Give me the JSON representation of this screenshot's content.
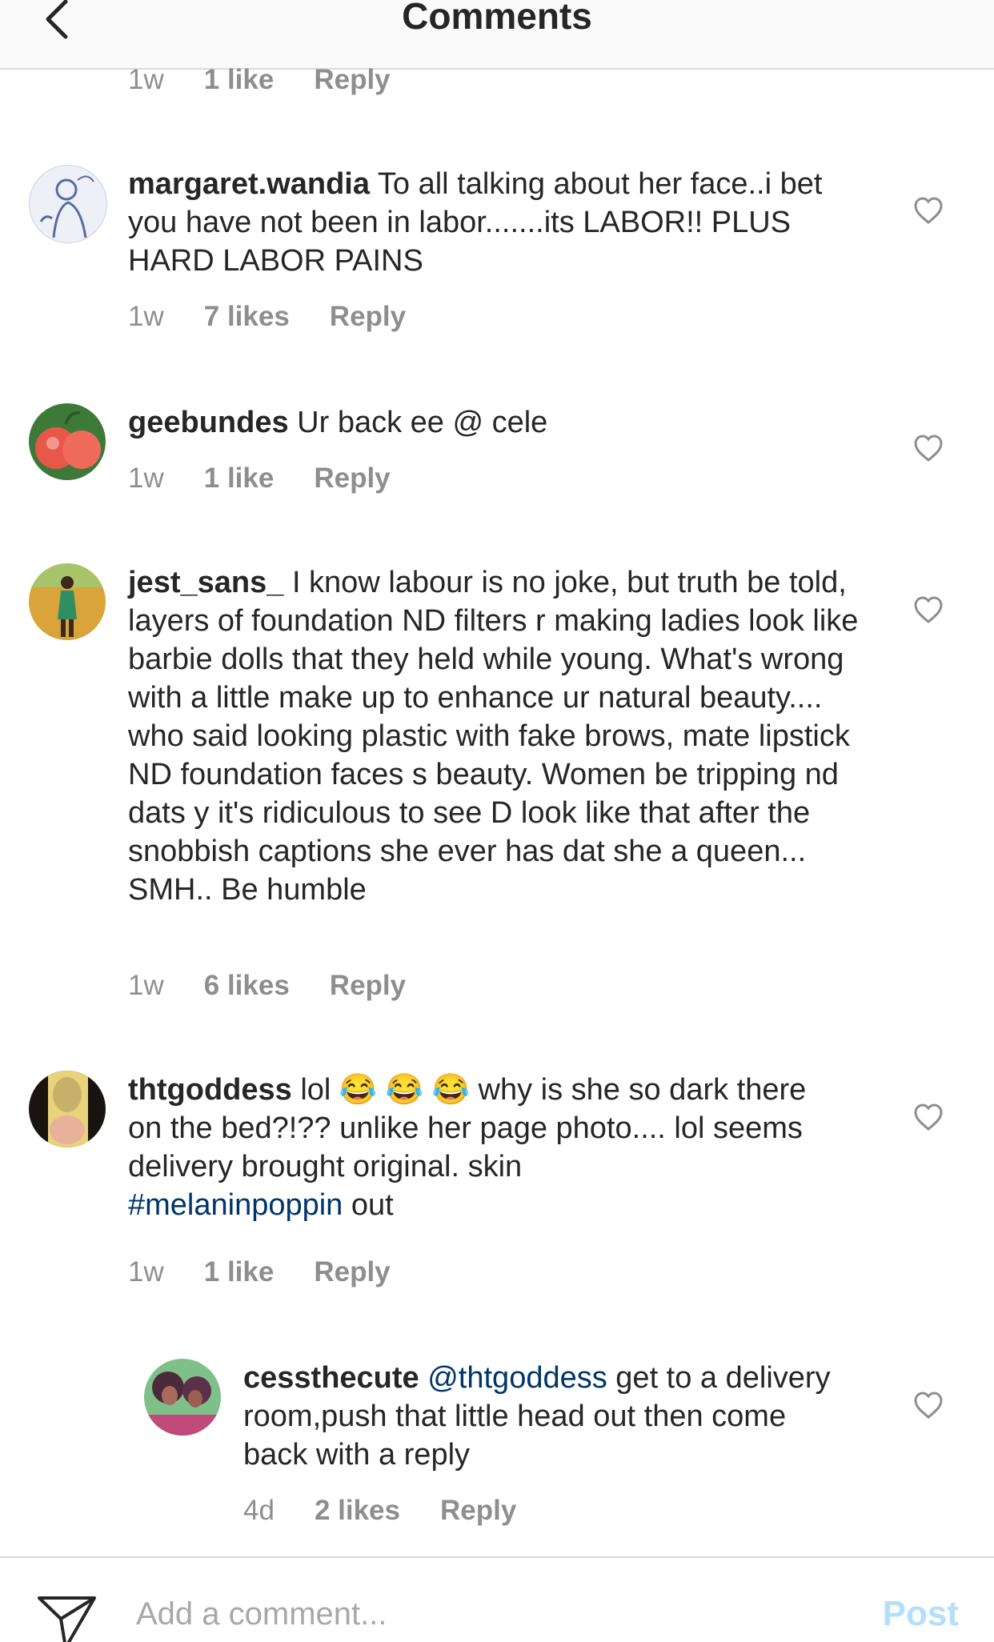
{
  "header": {
    "title": "Comments",
    "back_icon": "chevron-left-icon"
  },
  "previous_meta": {
    "time": "1w",
    "likes": "1 like",
    "reply": "Reply"
  },
  "comments": [
    {
      "username": "margaret.wandia",
      "text": "To all talking about her face..i bet you have not been in labor.......its LABOR!! PLUS HARD LABOR PAINS",
      "time": "1w",
      "likes": "7 likes",
      "reply": "Reply"
    },
    {
      "username": "geebundes",
      "text": "Ur back ee @ cele",
      "time": "1w",
      "likes": "1 like",
      "reply": "Reply"
    },
    {
      "username": "jest_sans_",
      "text": "I know labour is no joke, but truth be told, layers of foundation ND filters r making ladies look like barbie dolls that they held while young. What's wrong with a little make up to enhance ur natural beauty.... who said looking plastic with fake brows, mate lipstick ND foundation faces s beauty. Women be tripping nd dats y it's ridiculous to see D look like that after the snobbish captions she ever has dat she a queen... SMH.. Be humble",
      "time": "1w",
      "likes": "6 likes",
      "reply": "Reply"
    },
    {
      "username": "thtgoddess",
      "text_before": "lol 😂 😂 😂 why is she so dark there on the bed?!?? unlike her page photo.... lol seems delivery brought original. skin",
      "hashtag": "#melaninpoppin",
      "text_after": "out",
      "time": "1w",
      "likes": "1 like",
      "reply": "Reply"
    }
  ],
  "reply": {
    "username": "cessthecute",
    "mention": "@thtgoddess",
    "text": "get to a delivery room,push that little head out then come back with a reply",
    "time": "4d",
    "likes": "2 likes",
    "reply": "Reply"
  },
  "footer": {
    "send_icon": "paper-plane-icon",
    "placeholder": "Add a comment...",
    "post_label": "Post"
  },
  "colors": {
    "text": "#262626",
    "meta": "#8e8e8e",
    "link": "#003569",
    "post_disabled": "#b2dffc",
    "divider": "#dbdbdb"
  }
}
